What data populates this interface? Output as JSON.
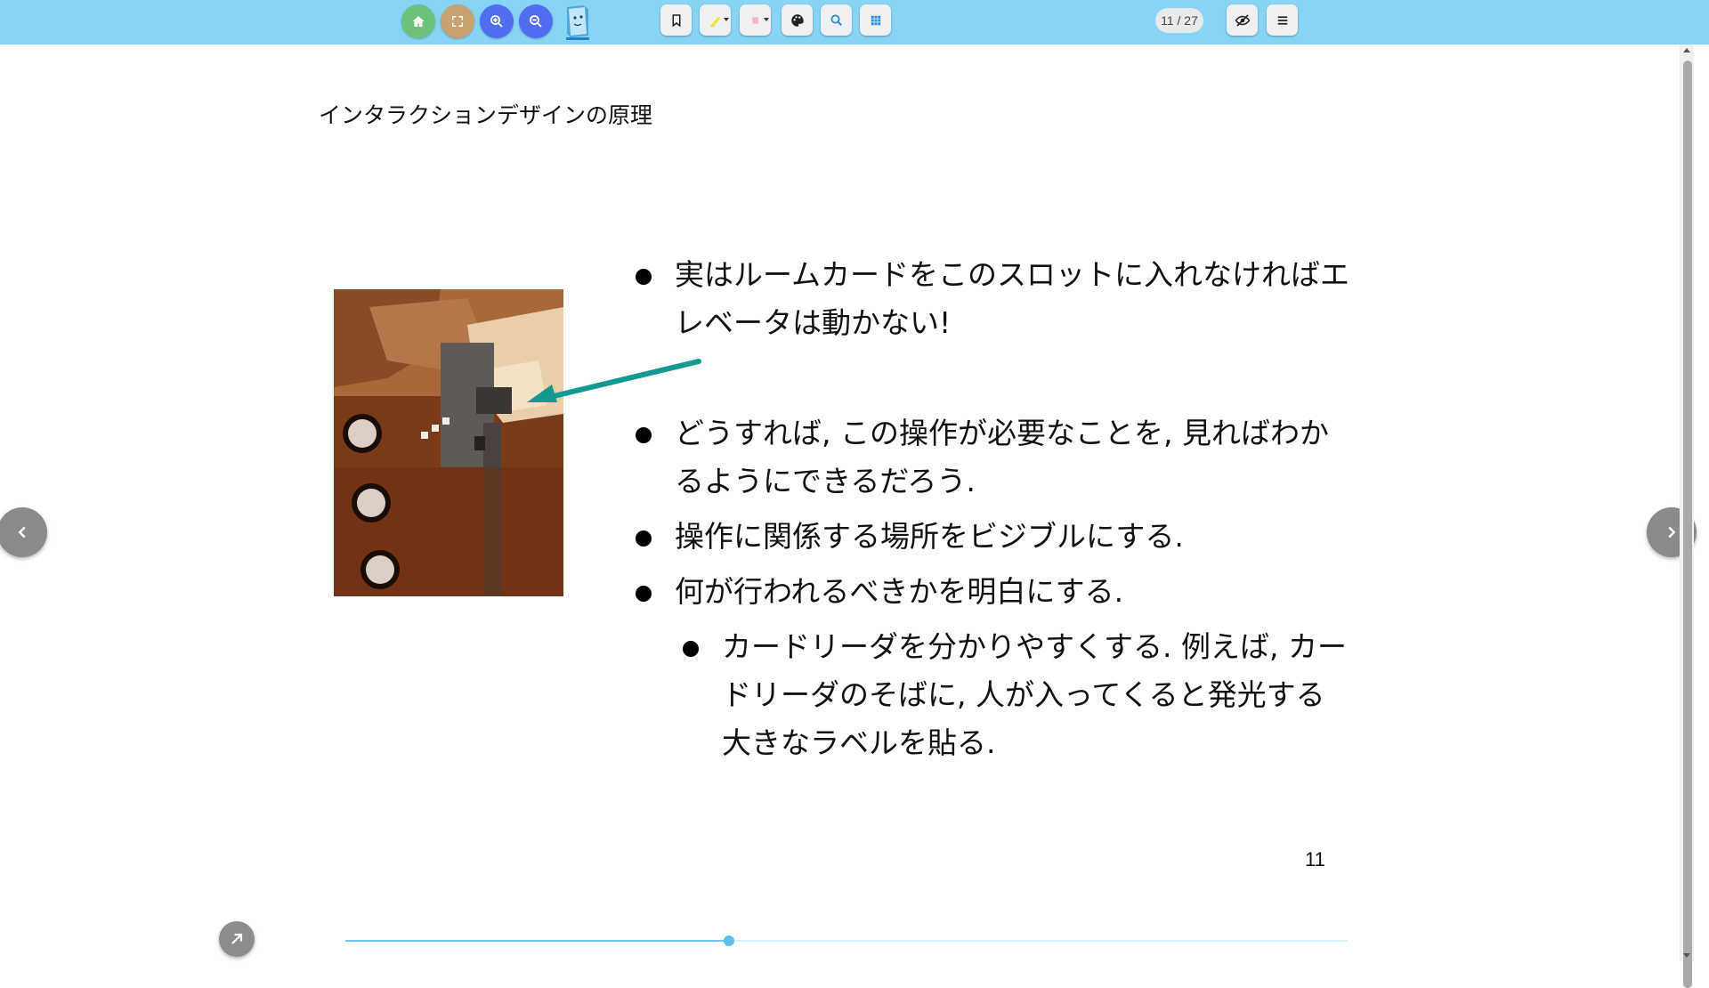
{
  "toolbar": {
    "buttons": [
      {
        "name": "home",
        "icon": "home-icon",
        "color": "#6cc27a"
      },
      {
        "name": "fullscreen",
        "icon": "fullscreen-icon",
        "color": "#c9a070"
      },
      {
        "name": "zoom-in",
        "icon": "zoom-in-icon",
        "color": "#4f6ff0"
      },
      {
        "name": "zoom-out",
        "icon": "zoom-out-icon",
        "color": "#4f6ff0"
      }
    ],
    "tools": [
      "bookmark-icon",
      "highlighter-icon",
      "eraser-icon",
      "palette-icon",
      "search-icon",
      "grid-icon"
    ],
    "page_counter": "11 / 27",
    "right_tools": [
      "hide-icon",
      "menu-icon"
    ]
  },
  "slide": {
    "title": "インタラクションデザインの原理",
    "bullets": [
      "実はルームカードをこのスロットに入れなければエレベータは動かない!",
      "どうすれば, この操作が必要なことを, 見ればわかるようにできるだろう.",
      "操作に関係する場所をビジブルにする.",
      "何が行われるべきかを明白にする."
    ],
    "sub_bullets": [
      "カードリーダを分かりやすくする. 例えば, カードリーダのそばに, 人が入ってくると発光する大きなラベルを貼る."
    ],
    "page_number": "11",
    "arrow_color": "#13998f"
  },
  "progress": {
    "fraction": 0.383,
    "color": "#6fc6ef"
  },
  "navigation": {
    "prev_icon": "chevron-left-icon",
    "next_icon": "chevron-right-icon",
    "expand_icon": "arrow-up-right-icon"
  }
}
